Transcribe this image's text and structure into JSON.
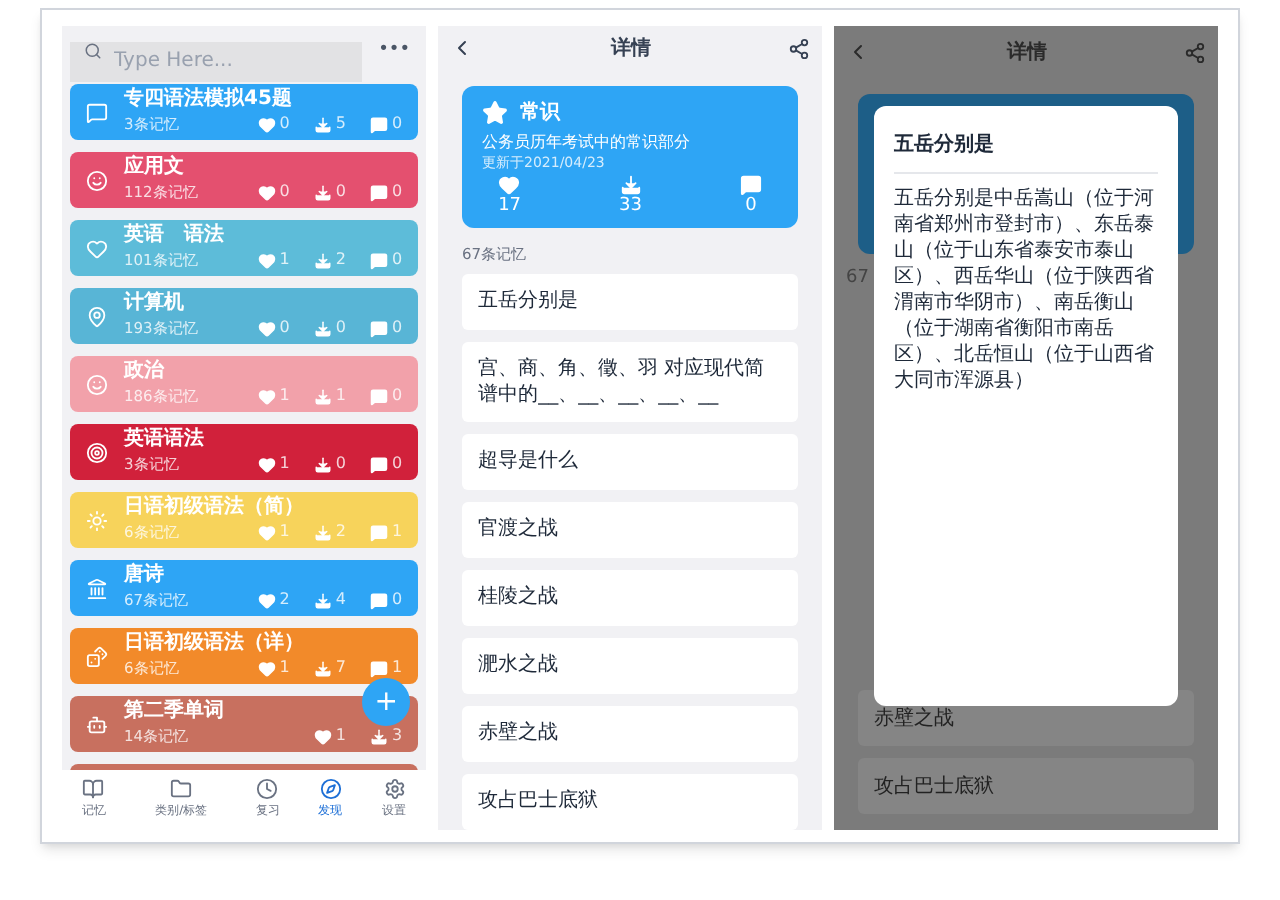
{
  "list_screen": {
    "search": {
      "placeholder": "Type Here..."
    },
    "more": "•••",
    "decks": [
      {
        "title": "专四语法模拟45题",
        "count": "3条记忆",
        "likes": "0",
        "downloads": "5",
        "comments": "0",
        "color": "#2ea5f5"
      },
      {
        "title": "应用文",
        "count": "112条记忆",
        "likes": "0",
        "downloads": "0",
        "comments": "0",
        "color": "#e4506f"
      },
      {
        "title": "英语　语法",
        "count": "101条记忆",
        "likes": "1",
        "downloads": "2",
        "comments": "0",
        "color": "#5dbcd9"
      },
      {
        "title": "计算机",
        "count": "193条记忆",
        "likes": "0",
        "downloads": "0",
        "comments": "0",
        "color": "#58b5d6"
      },
      {
        "title": "政治",
        "count": "186条记忆",
        "likes": "1",
        "downloads": "1",
        "comments": "0",
        "color": "#f2a1aa"
      },
      {
        "title": "英语语法",
        "count": "3条记忆",
        "likes": "1",
        "downloads": "0",
        "comments": "0",
        "color": "#d1213b"
      },
      {
        "title": "日语初级语法（简）",
        "count": "6条记忆",
        "likes": "1",
        "downloads": "2",
        "comments": "1",
        "color": "#f7d35b"
      },
      {
        "title": "唐诗",
        "count": "67条记忆",
        "likes": "2",
        "downloads": "4",
        "comments": "0",
        "color": "#2ea5f5"
      },
      {
        "title": "日语初级语法（详）",
        "count": "6条记忆",
        "likes": "1",
        "downloads": "7",
        "comments": "1",
        "color": "#f28a2a"
      },
      {
        "title": "第二季单词",
        "count": "14条记忆",
        "likes": "1",
        "downloads": "3",
        "color": "#c8705f"
      }
    ],
    "fab": "+",
    "nav": [
      {
        "label": "记忆",
        "selected": false
      },
      {
        "label": "类别/标签",
        "selected": false
      },
      {
        "label": "复习",
        "selected": false
      },
      {
        "label": "发现",
        "selected": true
      },
      {
        "label": "设置",
        "selected": false
      }
    ]
  },
  "detail_screen": {
    "title": "详情",
    "card": {
      "name": "常识",
      "description": "公务员历年考试中的常识部分",
      "updated": "更新于2021/04/23",
      "likes": "17",
      "downloads": "33",
      "comments": "0"
    },
    "memory_count": "67条记忆",
    "items": [
      "五岳分别是",
      "宫、商、角、徵、羽 对应现代简谱中的__、__、__、__、__",
      "超导是什么",
      "官渡之战",
      "桂陵之战",
      "淝水之战",
      "赤壁之战",
      "攻占巴士底狱"
    ]
  },
  "dialog_screen": {
    "title": "详情",
    "count_fragment": "67",
    "dialog": {
      "title": "五岳分别是",
      "body": "五岳分别是中岳嵩山（位于河南省郑州市登封市）、东岳泰山（位于山东省泰安市泰山区）、西岳华山（位于陕西省渭南市华阴市）、南岳衡山（位于湖南省衡阳市南岳区）、北岳恒山（位于山西省大同市浑源县）"
    },
    "items": [
      "赤壁之战",
      "攻占巴士底狱"
    ]
  }
}
